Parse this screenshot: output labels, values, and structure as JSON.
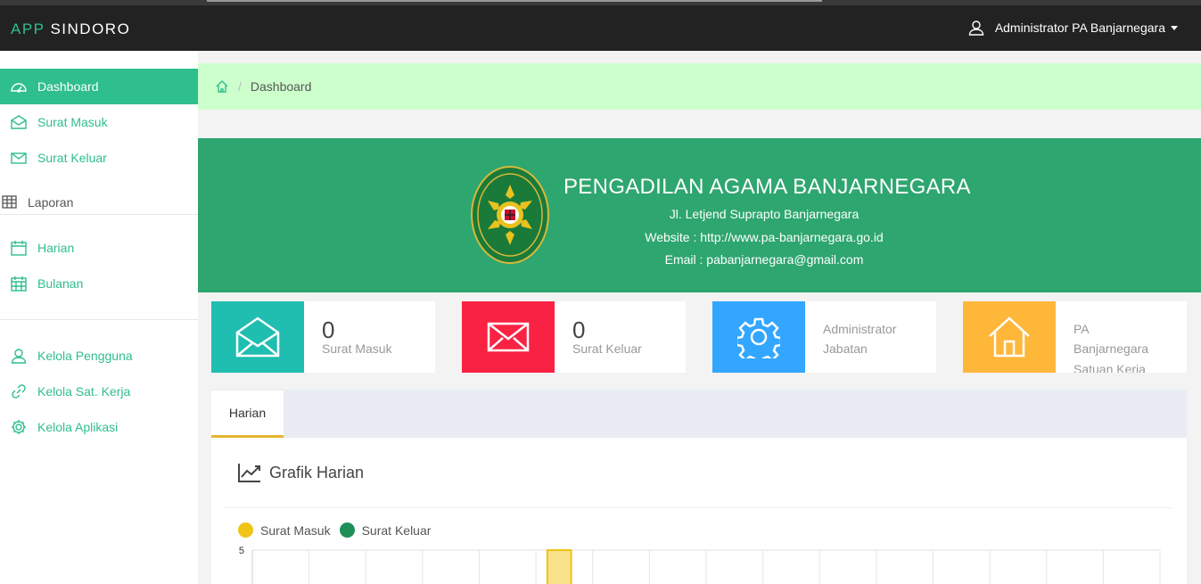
{
  "app": {
    "brand_prefix": "APP",
    "brand_name": "SINDORO"
  },
  "user": {
    "name": "Administrator PA Banjarnegara",
    "icon": "user-icon"
  },
  "sidebar": {
    "items": [
      {
        "label": "Dashboard",
        "icon": "dashboard-icon",
        "active": true
      },
      {
        "label": "Surat Masuk",
        "icon": "envelope-open-icon"
      },
      {
        "label": "Surat Keluar",
        "icon": "envelope-icon"
      }
    ],
    "report_header": "Laporan",
    "report_items": [
      {
        "label": "Harian",
        "icon": "calendar-icon"
      },
      {
        "label": "Bulanan",
        "icon": "calendar-grid-icon"
      }
    ],
    "admin_items": [
      {
        "label": "Kelola Pengguna",
        "icon": "user-icon"
      },
      {
        "label": "Kelola Sat. Kerja",
        "icon": "link-icon"
      },
      {
        "label": "Kelola Aplikasi",
        "icon": "gear-icon"
      }
    ]
  },
  "breadcrumb": {
    "home_icon": "home-icon",
    "current": "Dashboard"
  },
  "hero": {
    "title": "PENGADILAN AGAMA BANJARNEGARA",
    "address": "Jl. Letjend Suprapto Banjarnegara",
    "website": "Website : http://www.pa-banjarnegara.go.id",
    "email": "Email : pabanjarnegara@gmail.com",
    "logo_text": "PENGADILAN AGAMA BANJARNEGARA"
  },
  "cards": [
    {
      "value": "0",
      "label": "Surat Masuk",
      "color": "#1fbeb0",
      "icon": "envelope-open-icon"
    },
    {
      "value": "0",
      "label": "Surat Keluar",
      "color": "#fa2243",
      "icon": "envelope-icon"
    },
    {
      "line1": "Administrator",
      "line2": "Jabatan",
      "color": "#33a6ff",
      "icon": "gear-icon"
    },
    {
      "line1": "PA",
      "line2": "Banjarnegara",
      "line3": "Satuan Kerja",
      "color": "#ffb73a",
      "icon": "home-icon"
    }
  ],
  "tabs": [
    {
      "label": "Harian",
      "active": true
    }
  ],
  "panel": {
    "title": "Grafik Harian",
    "icon": "line-chart-icon"
  },
  "chart_data": {
    "type": "bar",
    "title": "",
    "series": [
      {
        "name": "Surat Masuk",
        "color": "#efc417"
      },
      {
        "name": "Surat Keluar",
        "color": "#1f8f5a"
      }
    ],
    "y_ticks": [
      "5"
    ],
    "ylim": [
      0,
      5
    ],
    "column_count": 16,
    "highlight_column": 5,
    "grid": true,
    "legend": "top-left"
  },
  "colors": {
    "accent": "#2fbe8e",
    "topbar": "#222222",
    "hero": "#2ea66f",
    "breadcrumb_bg": "#ccffcc",
    "tab_underline": "#e6b52e"
  }
}
